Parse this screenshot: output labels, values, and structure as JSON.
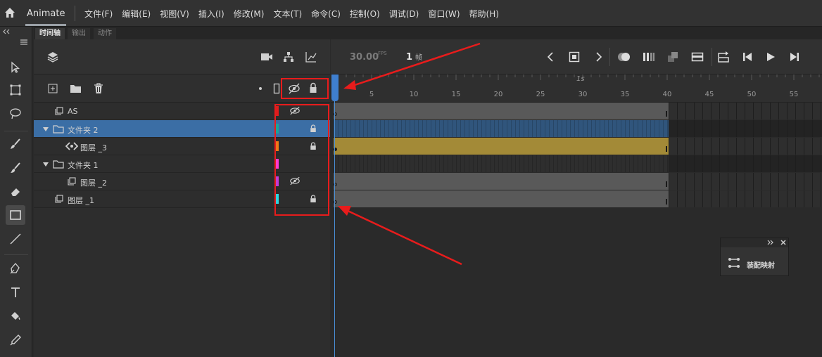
{
  "app": {
    "name": "Animate"
  },
  "menu": [
    "文件(F)",
    "编辑(E)",
    "视图(V)",
    "插入(I)",
    "修改(M)",
    "文本(T)",
    "命令(C)",
    "控制(O)",
    "调试(D)",
    "窗口(W)",
    "帮助(H)"
  ],
  "panel_tabs": [
    "时间轴",
    "输出",
    "动作"
  ],
  "timeline": {
    "fps_value": "30.00",
    "fps_unit": "FPS",
    "frame_value": "1",
    "frame_unit": "帧",
    "ruler_numbers": [
      "5",
      "10",
      "15",
      "20",
      "25",
      "30",
      "35",
      "40",
      "45",
      "50",
      "55"
    ],
    "ruler_label": "1s"
  },
  "layers": [
    {
      "name": "AS",
      "type": "layer",
      "indent": 0,
      "color": "#e01d1d",
      "hidden": true,
      "locked": false,
      "selected": false
    },
    {
      "name": "文件夹 2",
      "type": "folder",
      "indent": 0,
      "color": "#1aa39a",
      "hidden": false,
      "locked": true,
      "selected": true
    },
    {
      "name": "图层 _3",
      "type": "tween",
      "indent": 1,
      "color": "#f07a17",
      "hidden": false,
      "locked": true,
      "selected": false
    },
    {
      "name": "文件夹 1",
      "type": "folder",
      "indent": 0,
      "color": "#ff3bd3",
      "hidden": false,
      "locked": false,
      "selected": false
    },
    {
      "name": "图层 _2",
      "type": "layer",
      "indent": 1,
      "color": "#c43cd8",
      "hidden": true,
      "locked": false,
      "selected": false
    },
    {
      "name": "图层 _1",
      "type": "layer",
      "indent": 0,
      "color": "#2fd5e0",
      "hidden": false,
      "locked": true,
      "selected": false
    }
  ],
  "float_panel": {
    "label": "装配映射"
  },
  "colors": {
    "highlight": "#e81c1c",
    "playhead": "#3f7fcf",
    "selected_row": "#3b6ea5",
    "tween_fill": "#a38a37"
  }
}
